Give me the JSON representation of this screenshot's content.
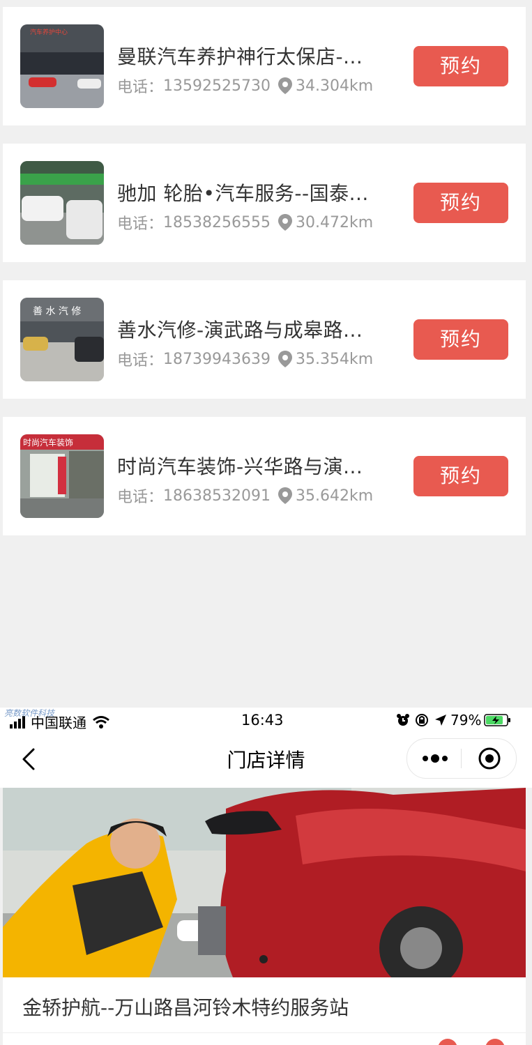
{
  "stores": [
    {
      "name": "曼联汽车养护神行太保店-...",
      "phone_label": "电话：",
      "phone": "13592525730",
      "distance": "34.304km",
      "book_label": "预约"
    },
    {
      "name": "驰加 轮胎•汽车服务--国泰...",
      "phone_label": "电话：",
      "phone": "18538256555",
      "distance": "30.472km",
      "book_label": "预约"
    },
    {
      "name": "善水汽修-演武路与成皋路...",
      "phone_label": "电话：",
      "phone": "18739943639",
      "distance": "35.354km",
      "book_label": "预约"
    },
    {
      "name": "时尚汽车装饰-兴华路与演...",
      "phone_label": "电话：",
      "phone": "18638532091",
      "distance": "35.642km",
      "book_label": "预约"
    }
  ],
  "thumb_signs": [
    "汽车养护中心",
    "",
    "善 水 汽 修",
    "时尚汽车装饰"
  ],
  "status_bar": {
    "carrier": "中国联通",
    "time": "16:43",
    "battery": "79%"
  },
  "watermark": "亮数软件科技",
  "nav": {
    "title": "门店详情"
  },
  "detail": {
    "store_title": "金轿护航--万山路昌河铃木特约服务站"
  },
  "colors": {
    "accent": "#e85a50",
    "background": "#f0f0f0"
  }
}
